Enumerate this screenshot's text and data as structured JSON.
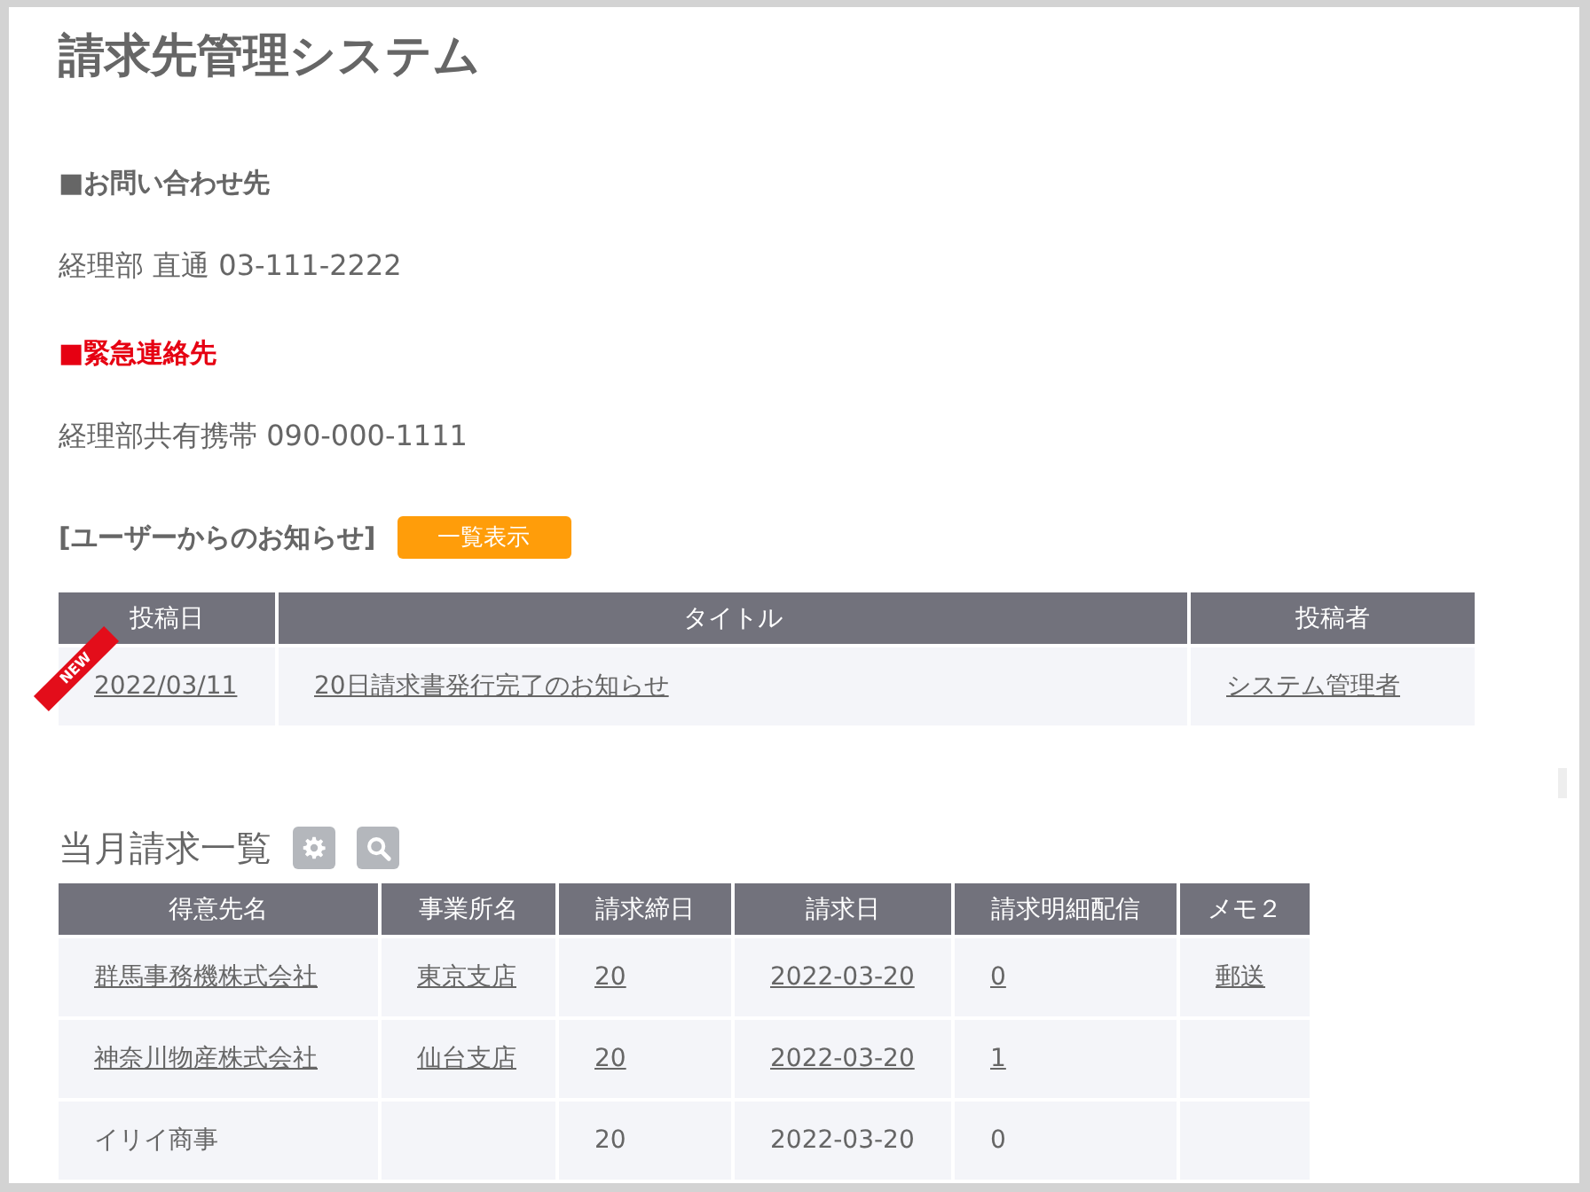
{
  "title": "請求先管理システム",
  "contacts": [
    {
      "heading": "■お問い合わせ先",
      "urgent": false,
      "text": "経理部 直通 03-111-2222"
    },
    {
      "heading": "■緊急連絡先",
      "urgent": true,
      "text": "経理部共有携帯 090-000-1111"
    }
  ],
  "notices": {
    "heading": "[ユーザーからのお知らせ]",
    "button": "一覧表示",
    "columns": [
      "投稿日",
      "タイトル",
      "投稿者"
    ],
    "rows": [
      {
        "badge": "NEW",
        "cells": [
          {
            "text": "2022/03/11",
            "link": true
          },
          {
            "text": "20日請求書発行完了のお知らせ",
            "link": true
          },
          {
            "text": "システム管理者",
            "link": true
          }
        ]
      }
    ]
  },
  "billing": {
    "heading": "当月請求一覧",
    "columns": [
      "得意先名",
      "事業所名",
      "請求締日",
      "請求日",
      "請求明細配信",
      "メモ２"
    ],
    "rows": [
      {
        "cells": [
          {
            "text": "群馬事務機株式会社",
            "link": true
          },
          {
            "text": "東京支店",
            "link": true
          },
          {
            "text": "20",
            "link": true
          },
          {
            "text": "2022-03-20",
            "link": true
          },
          {
            "text": "0",
            "link": true
          },
          {
            "text": "郵送",
            "link": true
          }
        ]
      },
      {
        "cells": [
          {
            "text": "神奈川物産株式会社",
            "link": true
          },
          {
            "text": "仙台支店",
            "link": true
          },
          {
            "text": "20",
            "link": true
          },
          {
            "text": "2022-03-20",
            "link": true
          },
          {
            "text": "1",
            "link": true
          },
          null
        ]
      },
      {
        "cells": [
          {
            "text": "イリイ商事",
            "link": false
          },
          null,
          {
            "text": "20",
            "link": false
          },
          {
            "text": "2022-03-20",
            "link": false
          },
          {
            "text": "0",
            "link": false
          },
          null
        ]
      }
    ]
  }
}
